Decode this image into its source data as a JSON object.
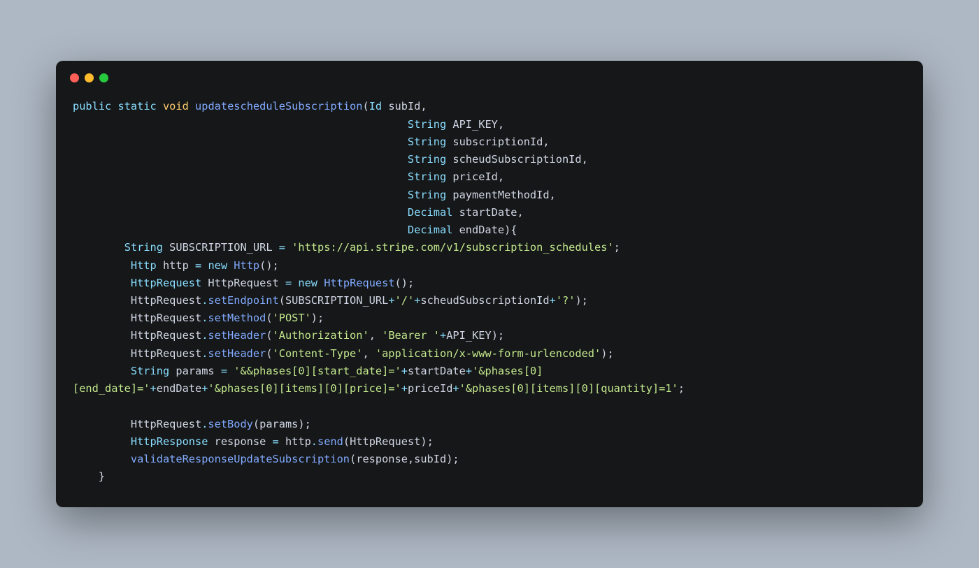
{
  "code": {
    "line1": {
      "kw_public": "public",
      "kw_static": "static",
      "kw_void": "void",
      "fn_name": "updatescheduleSubscription",
      "paren_open": "(",
      "type_id": "Id",
      "param_subid": "subId",
      "comma": ","
    },
    "line2": {
      "indent": "                                                    ",
      "type": "String",
      "param": "API_KEY",
      "comma": ","
    },
    "line3": {
      "indent": "                                                    ",
      "type": "String",
      "param": "subscriptionId",
      "comma": ","
    },
    "line4": {
      "indent": "                                                    ",
      "type": "String",
      "param": "scheudSubscriptionId",
      "comma": ","
    },
    "line5": {
      "indent": "                                                    ",
      "type": "String",
      "param": "priceId",
      "comma": ","
    },
    "line6": {
      "indent": "                                                    ",
      "type": "String",
      "param": "paymentMethodId",
      "comma": ","
    },
    "line7": {
      "indent": "                                                    ",
      "type": "Decimal",
      "param": "startDate",
      "comma": ","
    },
    "line8": {
      "indent": "                                                    ",
      "type": "Decimal",
      "param": "endDate",
      "paren_close": ")",
      "brace_open": "{"
    },
    "line9": {
      "indent": "        ",
      "type": "String",
      "var": "SUBSCRIPTION_URL",
      "eq": " = ",
      "str": "'https://api.stripe.com/v1/subscription_schedules'",
      "semi": ";"
    },
    "line10": {
      "indent": "         ",
      "type": "Http",
      "var": "http",
      "eq": " = ",
      "kw_new": "new",
      "ctor": " Http",
      "parens": "();"
    },
    "line11": {
      "indent": "         ",
      "type": "HttpRequest",
      "var": "HttpRequest",
      "eq": " = ",
      "kw_new": "new",
      "ctor": " HttpRequest",
      "parens": "();"
    },
    "line12": {
      "indent": "         ",
      "obj": "HttpRequest",
      "dot": ".",
      "method": "setEndpoint",
      "open": "(",
      "arg1": "SUBSCRIPTION_URL",
      "plus1": "+",
      "str1": "'/'",
      "plus2": "+",
      "arg2": "scheudSubscriptionId",
      "plus3": "+",
      "str2": "'?'",
      "close": ");"
    },
    "line13": {
      "indent": "         ",
      "obj": "HttpRequest",
      "dot": ".",
      "method": "setMethod",
      "open": "(",
      "str": "'POST'",
      "close": ");"
    },
    "line14": {
      "indent": "         ",
      "obj": "HttpRequest",
      "dot": ".",
      "method": "setHeader",
      "open": "(",
      "str1": "'Authorization'",
      "comma": ", ",
      "str2": "'Bearer '",
      "plus": "+",
      "arg": "API_KEY",
      "close": ");"
    },
    "line15": {
      "indent": "         ",
      "obj": "HttpRequest",
      "dot": ".",
      "method": "setHeader",
      "open": "(",
      "str1": "'Content-Type'",
      "comma": ", ",
      "str2": "'application/x-www-form-urlencoded'",
      "close": ");"
    },
    "line16": {
      "indent": "         ",
      "type": "String",
      "var": "params",
      "eq": " = ",
      "str1": "'&&phases[0][start_date]='",
      "plus1": "+",
      "arg1": "startDate",
      "plus2": "+",
      "str2": "'&phases[0]"
    },
    "line17": {
      "str1": "[end_date]='",
      "plus1": "+",
      "arg1": "endDate",
      "plus2": "+",
      "str2": "'&phases[0][items][0][price]='",
      "plus3": "+",
      "arg2": "priceId",
      "plus4": "+",
      "str3": "'&phases[0][items][0][quantity]=1'",
      "semi": ";"
    },
    "line18": "",
    "line19": {
      "indent": "         ",
      "obj": "HttpRequest",
      "dot": ".",
      "method": "setBody",
      "open": "(",
      "arg": "params",
      "close": ");"
    },
    "line20": {
      "indent": "         ",
      "type": "HttpResponse",
      "var": "response",
      "eq": " = ",
      "obj": "http",
      "dot": ".",
      "method": "send",
      "open": "(",
      "arg": "HttpRequest",
      "close": ");"
    },
    "line21": {
      "indent": "         ",
      "fn": "validateResponseUpdateSubscription",
      "open": "(",
      "arg1": "response",
      "comma": ",",
      "arg2": "subId",
      "close": ");"
    },
    "line22": {
      "indent": "    ",
      "brace": "}"
    }
  }
}
